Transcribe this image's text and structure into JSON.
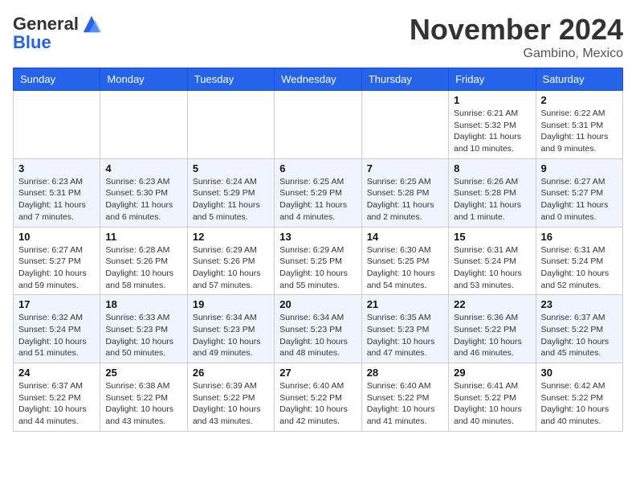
{
  "header": {
    "logo_line1": "General",
    "logo_line2": "Blue",
    "month": "November 2024",
    "location": "Gambino, Mexico"
  },
  "weekdays": [
    "Sunday",
    "Monday",
    "Tuesday",
    "Wednesday",
    "Thursday",
    "Friday",
    "Saturday"
  ],
  "weeks": [
    [
      {
        "day": "",
        "info": ""
      },
      {
        "day": "",
        "info": ""
      },
      {
        "day": "",
        "info": ""
      },
      {
        "day": "",
        "info": ""
      },
      {
        "day": "",
        "info": ""
      },
      {
        "day": "1",
        "info": "Sunrise: 6:21 AM\nSunset: 5:32 PM\nDaylight: 11 hours and 10 minutes."
      },
      {
        "day": "2",
        "info": "Sunrise: 6:22 AM\nSunset: 5:31 PM\nDaylight: 11 hours and 9 minutes."
      }
    ],
    [
      {
        "day": "3",
        "info": "Sunrise: 6:23 AM\nSunset: 5:31 PM\nDaylight: 11 hours and 7 minutes."
      },
      {
        "day": "4",
        "info": "Sunrise: 6:23 AM\nSunset: 5:30 PM\nDaylight: 11 hours and 6 minutes."
      },
      {
        "day": "5",
        "info": "Sunrise: 6:24 AM\nSunset: 5:29 PM\nDaylight: 11 hours and 5 minutes."
      },
      {
        "day": "6",
        "info": "Sunrise: 6:25 AM\nSunset: 5:29 PM\nDaylight: 11 hours and 4 minutes."
      },
      {
        "day": "7",
        "info": "Sunrise: 6:25 AM\nSunset: 5:28 PM\nDaylight: 11 hours and 2 minutes."
      },
      {
        "day": "8",
        "info": "Sunrise: 6:26 AM\nSunset: 5:28 PM\nDaylight: 11 hours and 1 minute."
      },
      {
        "day": "9",
        "info": "Sunrise: 6:27 AM\nSunset: 5:27 PM\nDaylight: 11 hours and 0 minutes."
      }
    ],
    [
      {
        "day": "10",
        "info": "Sunrise: 6:27 AM\nSunset: 5:27 PM\nDaylight: 10 hours and 59 minutes."
      },
      {
        "day": "11",
        "info": "Sunrise: 6:28 AM\nSunset: 5:26 PM\nDaylight: 10 hours and 58 minutes."
      },
      {
        "day": "12",
        "info": "Sunrise: 6:29 AM\nSunset: 5:26 PM\nDaylight: 10 hours and 57 minutes."
      },
      {
        "day": "13",
        "info": "Sunrise: 6:29 AM\nSunset: 5:25 PM\nDaylight: 10 hours and 55 minutes."
      },
      {
        "day": "14",
        "info": "Sunrise: 6:30 AM\nSunset: 5:25 PM\nDaylight: 10 hours and 54 minutes."
      },
      {
        "day": "15",
        "info": "Sunrise: 6:31 AM\nSunset: 5:24 PM\nDaylight: 10 hours and 53 minutes."
      },
      {
        "day": "16",
        "info": "Sunrise: 6:31 AM\nSunset: 5:24 PM\nDaylight: 10 hours and 52 minutes."
      }
    ],
    [
      {
        "day": "17",
        "info": "Sunrise: 6:32 AM\nSunset: 5:24 PM\nDaylight: 10 hours and 51 minutes."
      },
      {
        "day": "18",
        "info": "Sunrise: 6:33 AM\nSunset: 5:23 PM\nDaylight: 10 hours and 50 minutes."
      },
      {
        "day": "19",
        "info": "Sunrise: 6:34 AM\nSunset: 5:23 PM\nDaylight: 10 hours and 49 minutes."
      },
      {
        "day": "20",
        "info": "Sunrise: 6:34 AM\nSunset: 5:23 PM\nDaylight: 10 hours and 48 minutes."
      },
      {
        "day": "21",
        "info": "Sunrise: 6:35 AM\nSunset: 5:23 PM\nDaylight: 10 hours and 47 minutes."
      },
      {
        "day": "22",
        "info": "Sunrise: 6:36 AM\nSunset: 5:22 PM\nDaylight: 10 hours and 46 minutes."
      },
      {
        "day": "23",
        "info": "Sunrise: 6:37 AM\nSunset: 5:22 PM\nDaylight: 10 hours and 45 minutes."
      }
    ],
    [
      {
        "day": "24",
        "info": "Sunrise: 6:37 AM\nSunset: 5:22 PM\nDaylight: 10 hours and 44 minutes."
      },
      {
        "day": "25",
        "info": "Sunrise: 6:38 AM\nSunset: 5:22 PM\nDaylight: 10 hours and 43 minutes."
      },
      {
        "day": "26",
        "info": "Sunrise: 6:39 AM\nSunset: 5:22 PM\nDaylight: 10 hours and 43 minutes."
      },
      {
        "day": "27",
        "info": "Sunrise: 6:40 AM\nSunset: 5:22 PM\nDaylight: 10 hours and 42 minutes."
      },
      {
        "day": "28",
        "info": "Sunrise: 6:40 AM\nSunset: 5:22 PM\nDaylight: 10 hours and 41 minutes."
      },
      {
        "day": "29",
        "info": "Sunrise: 6:41 AM\nSunset: 5:22 PM\nDaylight: 10 hours and 40 minutes."
      },
      {
        "day": "30",
        "info": "Sunrise: 6:42 AM\nSunset: 5:22 PM\nDaylight: 10 hours and 40 minutes."
      }
    ]
  ]
}
